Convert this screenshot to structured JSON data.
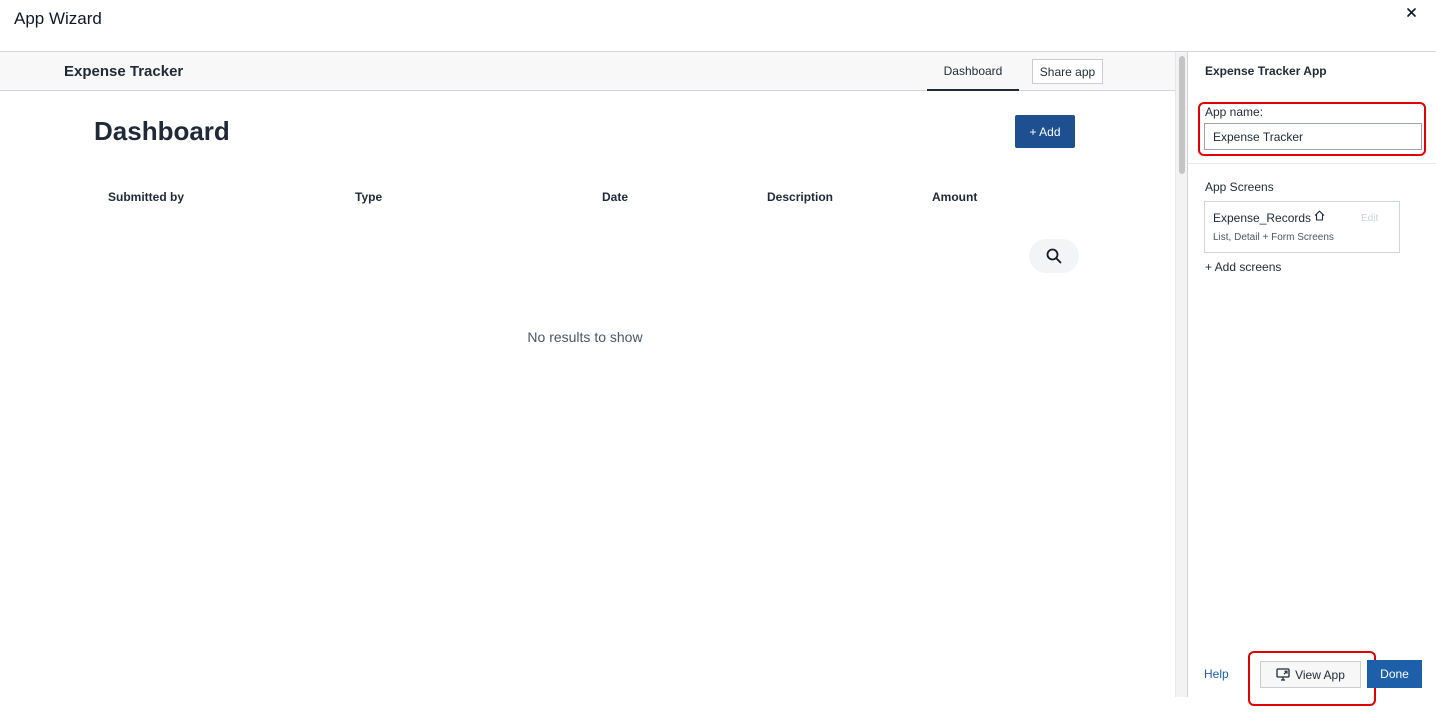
{
  "dialog": {
    "title": "App Wizard",
    "close_label": "×"
  },
  "preview": {
    "app_title": "Expense Tracker",
    "nav_tab": "Dashboard",
    "share_button": "Share app",
    "page_title": "Dashboard",
    "add_button": "+ Add",
    "columns": [
      "Submitted by",
      "Type",
      "Date",
      "Description",
      "Amount"
    ],
    "empty_message": "No results to show"
  },
  "panel": {
    "title": "Expense Tracker App",
    "app_name_label": "App name:",
    "app_name_value": "Expense Tracker",
    "screens_heading": "App Screens",
    "screens": [
      {
        "name": "Expense_Records",
        "icon": "home-icon",
        "edit_label": "Edit",
        "description": "List, Detail + Form Screens"
      }
    ],
    "add_screens_label": "+ Add screens",
    "help_label": "Help",
    "view_app_label": "View App",
    "done_label": "Done"
  },
  "colors": {
    "primary_button": "#1d4f91",
    "done_button": "#1d5fa8",
    "highlight": "#e00000"
  }
}
